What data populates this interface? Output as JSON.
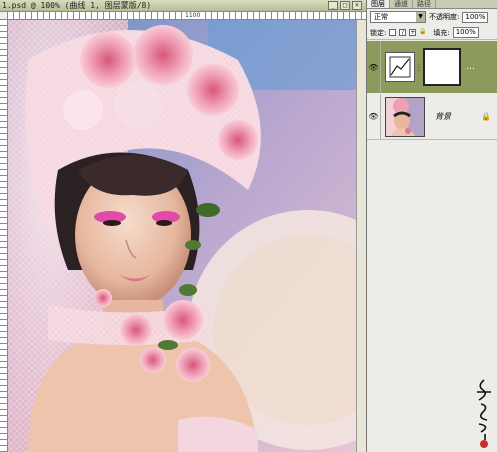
{
  "document": {
    "title": "1.psd @ 100% (曲线 1, 图层蒙版/8)",
    "ruler_top_label": "1100"
  },
  "layers_panel": {
    "tabs": [
      {
        "label": "图层"
      },
      {
        "label": "通道"
      },
      {
        "label": "路径"
      }
    ],
    "blend_mode": "正常",
    "opacity_label": "不透明度:",
    "opacity_value": "100%",
    "lock_label": "锁定:",
    "fill_label": "填充:",
    "fill_value": "100%",
    "layers": [
      {
        "name": "",
        "type": "curves-adjustment",
        "selected": true,
        "icon": "curves-icon"
      },
      {
        "name": "背景",
        "type": "background",
        "selected": false,
        "locked": true
      }
    ]
  },
  "colors": {
    "selected_layer": "#8c9a5c",
    "panel_bg": "#ecece8",
    "titlebar": "#c8cba8"
  }
}
